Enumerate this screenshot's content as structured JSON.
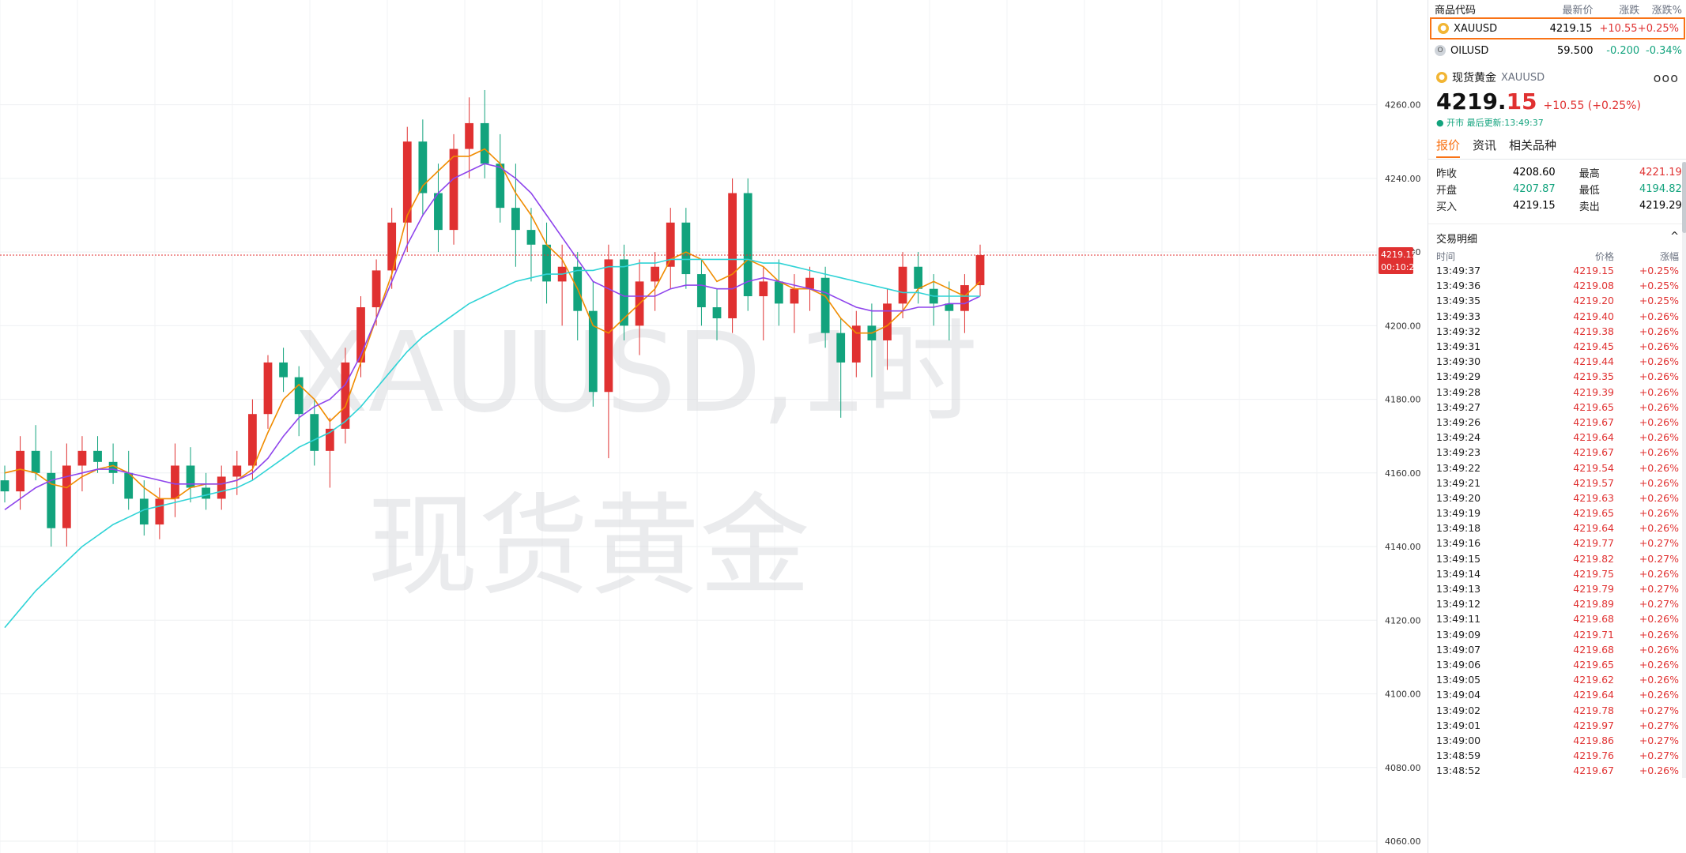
{
  "chart": {
    "watermark_symbol": "XAUUSD,1时",
    "watermark_name": "现货黄金",
    "price_tag": "4219.15",
    "countdown_tag": "00:10:22",
    "colors": {
      "up": "#e03131",
      "down": "#12a37d",
      "ma_short": "#f08c00",
      "ma_mid": "#8e44ec",
      "ma_long": "#2fd3d6",
      "price_line": "#e03131"
    }
  },
  "chart_data": {
    "type": "candlestick",
    "symbol": "XAUUSD",
    "interval": "1时",
    "ylim": [
      4060,
      4270
    ],
    "y_ticks": [
      "4260.00",
      "4240.00",
      "4220.00",
      "4200.00",
      "4180.00",
      "4160.00",
      "4140.00",
      "4120.00",
      "4100.00",
      "4080.00",
      "4060.00"
    ],
    "last_price": 4219.15,
    "candles": [
      [
        4158,
        4162,
        4152,
        4155
      ],
      [
        4155,
        4170,
        4150,
        4166
      ],
      [
        4166,
        4173,
        4158,
        4160
      ],
      [
        4160,
        4166,
        4140,
        4145
      ],
      [
        4145,
        4168,
        4140,
        4162
      ],
      [
        4162,
        4170,
        4155,
        4166
      ],
      [
        4166,
        4170,
        4160,
        4163
      ],
      [
        4163,
        4168,
        4157,
        4160
      ],
      [
        4160,
        4166,
        4150,
        4153
      ],
      [
        4153,
        4158,
        4143,
        4146
      ],
      [
        4146,
        4156,
        4142,
        4153
      ],
      [
        4153,
        4168,
        4148,
        4162
      ],
      [
        4162,
        4167,
        4152,
        4156
      ],
      [
        4156,
        4160,
        4150,
        4153
      ],
      [
        4153,
        4162,
        4150,
        4159
      ],
      [
        4159,
        4166,
        4154,
        4162
      ],
      [
        4162,
        4180,
        4158,
        4176
      ],
      [
        4176,
        4192,
        4172,
        4190
      ],
      [
        4190,
        4194,
        4182,
        4186
      ],
      [
        4186,
        4189,
        4170,
        4176
      ],
      [
        4176,
        4180,
        4162,
        4166
      ],
      [
        4166,
        4175,
        4156,
        4172
      ],
      [
        4172,
        4194,
        4168,
        4190
      ],
      [
        4190,
        4208,
        4186,
        4205
      ],
      [
        4205,
        4218,
        4200,
        4215
      ],
      [
        4215,
        4232,
        4210,
        4228
      ],
      [
        4228,
        4254,
        4220,
        4250
      ],
      [
        4250,
        4256,
        4230,
        4236
      ],
      [
        4236,
        4244,
        4220,
        4226
      ],
      [
        4226,
        4252,
        4222,
        4248
      ],
      [
        4248,
        4262,
        4240,
        4255
      ],
      [
        4255,
        4264,
        4240,
        4244
      ],
      [
        4244,
        4252,
        4228,
        4232
      ],
      [
        4232,
        4244,
        4216,
        4226
      ],
      [
        4226,
        4232,
        4212,
        4222
      ],
      [
        4222,
        4228,
        4206,
        4212
      ],
      [
        4212,
        4222,
        4200,
        4216
      ],
      [
        4216,
        4220,
        4196,
        4204
      ],
      [
        4204,
        4212,
        4178,
        4182
      ],
      [
        4182,
        4222,
        4164,
        4218
      ],
      [
        4218,
        4222,
        4196,
        4200
      ],
      [
        4200,
        4218,
        4192,
        4212
      ],
      [
        4212,
        4220,
        4204,
        4216
      ],
      [
        4216,
        4232,
        4210,
        4228
      ],
      [
        4228,
        4232,
        4210,
        4214
      ],
      [
        4214,
        4218,
        4200,
        4205
      ],
      [
        4205,
        4210,
        4196,
        4202
      ],
      [
        4202,
        4240,
        4198,
        4236
      ],
      [
        4236,
        4240,
        4204,
        4208
      ],
      [
        4208,
        4216,
        4196,
        4212
      ],
      [
        4212,
        4218,
        4200,
        4206
      ],
      [
        4206,
        4214,
        4198,
        4210
      ],
      [
        4210,
        4216,
        4204,
        4213
      ],
      [
        4213,
        4216,
        4194,
        4198
      ],
      [
        4198,
        4202,
        4175,
        4190
      ],
      [
        4190,
        4204,
        4186,
        4200
      ],
      [
        4200,
        4206,
        4186,
        4196
      ],
      [
        4196,
        4210,
        4188,
        4206
      ],
      [
        4206,
        4220,
        4202,
        4216
      ],
      [
        4216,
        4220,
        4206,
        4210
      ],
      [
        4210,
        4214,
        4200,
        4206
      ],
      [
        4206,
        4212,
        4196,
        4204
      ],
      [
        4204,
        4214,
        4198,
        4211
      ],
      [
        4211,
        4222,
        4208,
        4219.15
      ]
    ],
    "ma_short": [
      4160,
      4161,
      4160,
      4157,
      4156,
      4159,
      4161,
      4162,
      4160,
      4156,
      4153,
      4153,
      4156,
      4157,
      4157,
      4158,
      4161,
      4171,
      4180,
      4184,
      4180,
      4174,
      4178,
      4190,
      4202,
      4214,
      4230,
      4238,
      4242,
      4246,
      4246,
      4248,
      4244,
      4236,
      4230,
      4222,
      4218,
      4210,
      4200,
      4198,
      4202,
      4206,
      4210,
      4218,
      4220,
      4218,
      4212,
      4214,
      4218,
      4216,
      4212,
      4210,
      4210,
      4208,
      4202,
      4198,
      4198,
      4200,
      4204,
      4210,
      4212,
      4210,
      4208,
      4212
    ],
    "ma_mid": [
      4150,
      4153,
      4156,
      4158,
      4159,
      4160,
      4161,
      4161,
      4160,
      4159,
      4158,
      4157,
      4157,
      4157,
      4157,
      4158,
      4160,
      4164,
      4170,
      4175,
      4178,
      4180,
      4184,
      4192,
      4202,
      4212,
      4222,
      4230,
      4236,
      4240,
      4242,
      4244,
      4243,
      4240,
      4236,
      4230,
      4224,
      4218,
      4212,
      4210,
      4208,
      4208,
      4208,
      4210,
      4211,
      4211,
      4210,
      4210,
      4212,
      4213,
      4212,
      4211,
      4210,
      4209,
      4207,
      4205,
      4204,
      4204,
      4204,
      4205,
      4205,
      4206,
      4206,
      4208
    ],
    "ma_long": [
      4118,
      4123,
      4128,
      4132,
      4136,
      4140,
      4143,
      4146,
      4148,
      4150,
      4151,
      4152,
      4153,
      4154,
      4155,
      4156,
      4158,
      4161,
      4164,
      4167,
      4169,
      4171,
      4174,
      4178,
      4183,
      4188,
      4193,
      4197,
      4200,
      4203,
      4206,
      4208,
      4210,
      4212,
      4213,
      4214,
      4214,
      4215,
      4215,
      4216,
      4216,
      4217,
      4217,
      4218,
      4218,
      4218,
      4218,
      4218,
      4218,
      4217,
      4217,
      4216,
      4215,
      4214,
      4213,
      4212,
      4211,
      4210,
      4209,
      4209,
      4208,
      4208,
      4208,
      4208
    ]
  },
  "watchlist": {
    "headers": {
      "code": "商品代码",
      "last": "最新价",
      "change": "涨跌",
      "pct": "涨跌%"
    },
    "rows": [
      {
        "icon": "gold-icon",
        "code": "XAUUSD",
        "last": "4219.15",
        "change": "+10.55",
        "pct": "+0.25%"
      },
      {
        "icon": "oil-icon",
        "code": "OILUSD",
        "last": "59.500",
        "change": "-0.200",
        "pct": "-0.34%"
      }
    ]
  },
  "detail": {
    "name": "现货黄金",
    "code": "XAUUSD",
    "more": "ooo",
    "price_main": "4219.",
    "price_tail": "15",
    "change": "+10.55 (+0.25%)",
    "status": "● 开市 最后更新:13:49:37",
    "tabs": [
      "报价",
      "资讯",
      "相关品种"
    ],
    "stats": [
      {
        "l1": "昨收",
        "v1": "4208.60",
        "l2": "最高",
        "v2": "4221.19"
      },
      {
        "l1": "开盘",
        "v1": "4207.87",
        "l2": "最低",
        "v2": "4194.82"
      },
      {
        "l1": "买入",
        "v1": "4219.15",
        "l2": "卖出",
        "v2": "4219.29"
      }
    ]
  },
  "trades": {
    "title": "交易明细",
    "collapse": "^",
    "col_time": "时间",
    "col_price": "价格",
    "col_pct": "涨幅",
    "rows": [
      [
        "13:49:37",
        "4219.15",
        "+0.25%"
      ],
      [
        "13:49:36",
        "4219.08",
        "+0.25%"
      ],
      [
        "13:49:35",
        "4219.20",
        "+0.25%"
      ],
      [
        "13:49:33",
        "4219.40",
        "+0.26%"
      ],
      [
        "13:49:32",
        "4219.38",
        "+0.26%"
      ],
      [
        "13:49:31",
        "4219.45",
        "+0.26%"
      ],
      [
        "13:49:30",
        "4219.44",
        "+0.26%"
      ],
      [
        "13:49:29",
        "4219.35",
        "+0.26%"
      ],
      [
        "13:49:28",
        "4219.39",
        "+0.26%"
      ],
      [
        "13:49:27",
        "4219.65",
        "+0.26%"
      ],
      [
        "13:49:26",
        "4219.67",
        "+0.26%"
      ],
      [
        "13:49:24",
        "4219.64",
        "+0.26%"
      ],
      [
        "13:49:23",
        "4219.67",
        "+0.26%"
      ],
      [
        "13:49:22",
        "4219.54",
        "+0.26%"
      ],
      [
        "13:49:21",
        "4219.57",
        "+0.26%"
      ],
      [
        "13:49:20",
        "4219.63",
        "+0.26%"
      ],
      [
        "13:49:19",
        "4219.65",
        "+0.26%"
      ],
      [
        "13:49:18",
        "4219.64",
        "+0.26%"
      ],
      [
        "13:49:16",
        "4219.77",
        "+0.27%"
      ],
      [
        "13:49:15",
        "4219.82",
        "+0.27%"
      ],
      [
        "13:49:14",
        "4219.75",
        "+0.26%"
      ],
      [
        "13:49:13",
        "4219.79",
        "+0.27%"
      ],
      [
        "13:49:12",
        "4219.89",
        "+0.27%"
      ],
      [
        "13:49:11",
        "4219.68",
        "+0.26%"
      ],
      [
        "13:49:09",
        "4219.71",
        "+0.26%"
      ],
      [
        "13:49:07",
        "4219.68",
        "+0.26%"
      ],
      [
        "13:49:06",
        "4219.65",
        "+0.26%"
      ],
      [
        "13:49:05",
        "4219.62",
        "+0.26%"
      ],
      [
        "13:49:04",
        "4219.64",
        "+0.26%"
      ],
      [
        "13:49:02",
        "4219.78",
        "+0.27%"
      ],
      [
        "13:49:01",
        "4219.97",
        "+0.27%"
      ],
      [
        "13:49:00",
        "4219.86",
        "+0.27%"
      ],
      [
        "13:48:59",
        "4219.76",
        "+0.27%"
      ],
      [
        "13:48:52",
        "4219.67",
        "+0.26%"
      ]
    ]
  }
}
